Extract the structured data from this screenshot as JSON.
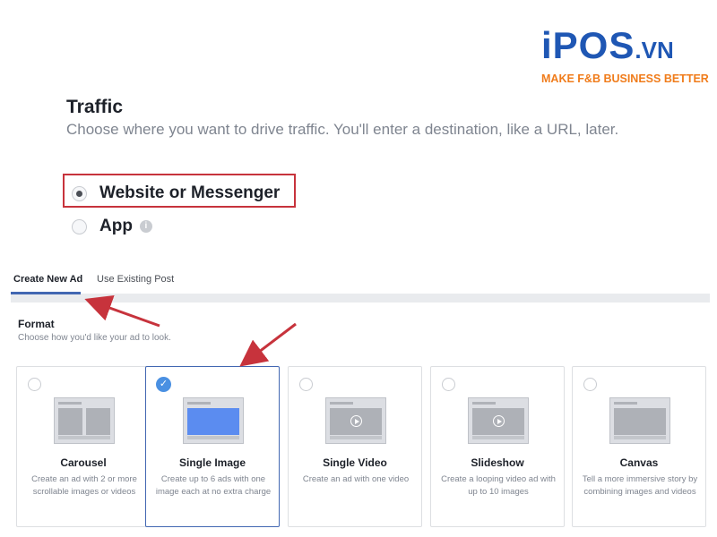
{
  "brand": {
    "logo": "iPOS",
    "logo_suffix": ".VN",
    "tagline": "MAKE F&B BUSINESS BETTER"
  },
  "traffic": {
    "title": "Traffic",
    "subtitle": "Choose where you want to drive traffic. You'll enter a destination, like a URL, later.",
    "options": [
      {
        "label": "Website or Messenger",
        "selected": true
      },
      {
        "label": "App",
        "selected": false
      }
    ],
    "info_glyph": "i"
  },
  "tabs": [
    {
      "label": "Create New Ad",
      "active": true
    },
    {
      "label": "Use Existing Post",
      "active": false
    }
  ],
  "format": {
    "title": "Format",
    "subtitle": "Choose how you'd like your ad to look.",
    "check_glyph": "✓",
    "cards": [
      {
        "title": "Carousel",
        "description": "Create an ad with 2 or more scrollable images or videos",
        "selected": false
      },
      {
        "title": "Single Image",
        "description": "Create up to 6 ads with one image each at no extra charge",
        "selected": true
      },
      {
        "title": "Single Video",
        "description": "Create an ad with one video",
        "selected": false
      },
      {
        "title": "Slideshow",
        "description": "Create a looping video ad with up to 10 images",
        "selected": false
      },
      {
        "title": "Canvas",
        "description": "Tell a more immersive story by combining images and videos",
        "selected": false
      }
    ]
  },
  "colors": {
    "accent": "#4267b2",
    "highlight": "#c7333c",
    "brand_blue": "#1f57b4",
    "brand_orange": "#f07c1b"
  }
}
